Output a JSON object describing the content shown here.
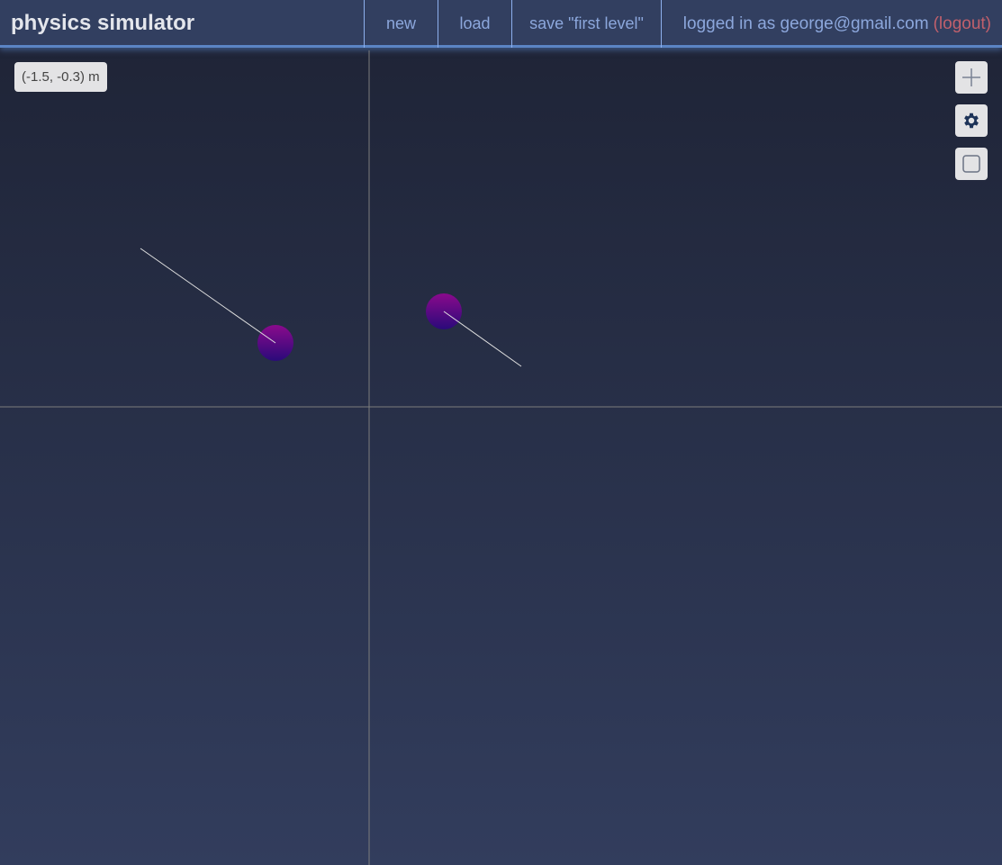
{
  "header": {
    "title": "physics simulator",
    "nav": [
      {
        "label": "new"
      },
      {
        "label": "load"
      },
      {
        "label": "save \"first level\""
      }
    ],
    "user_text": "logged in as george@gmail.com",
    "logout_label": "(logout)"
  },
  "canvas": {
    "coordinate_readout": "(-1.5, -0.3) m"
  },
  "toolbar": [
    {
      "icon": "plus-icon"
    },
    {
      "icon": "gear-icon"
    },
    {
      "icon": "square-icon"
    }
  ],
  "colors": {
    "accent": "#5b84c4",
    "nav_text": "#8ca7dc",
    "logout": "#c0606c",
    "ball_top": "#8a0a8c",
    "ball_bottom": "#2a0a7a"
  }
}
